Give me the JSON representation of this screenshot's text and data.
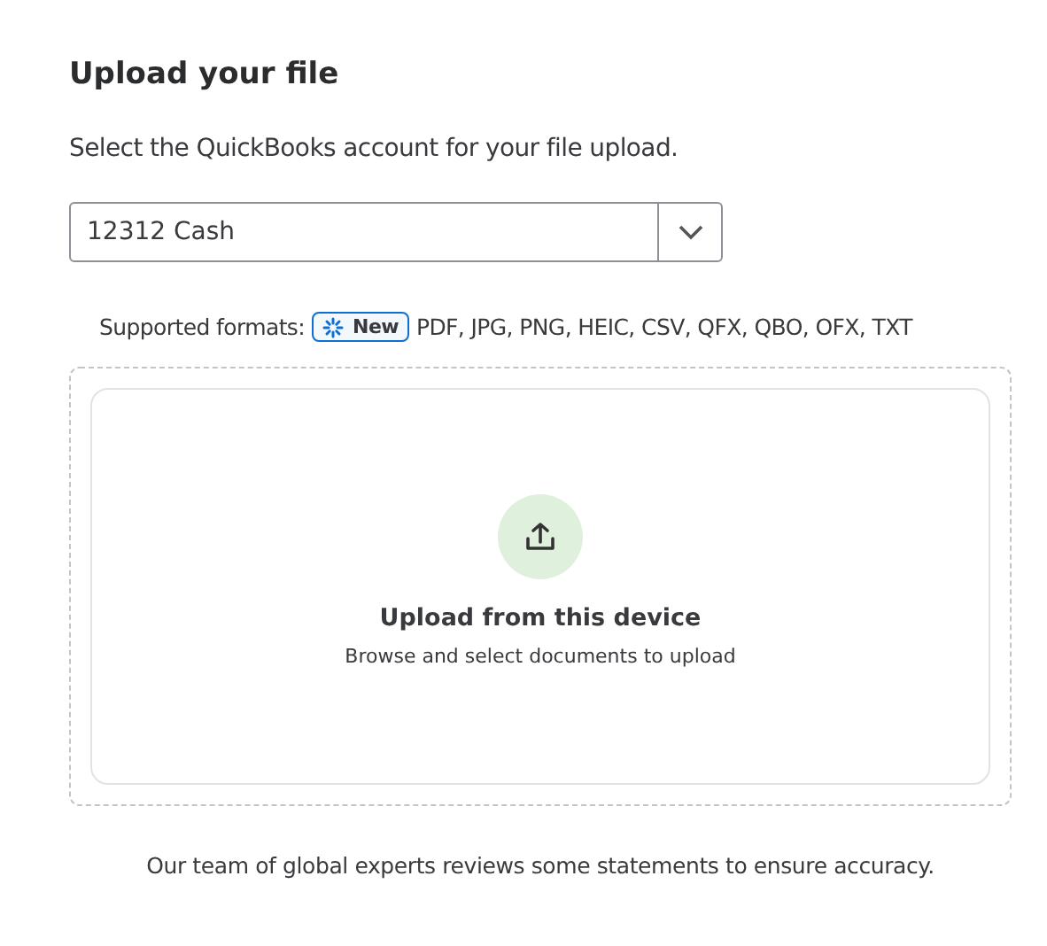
{
  "heading": "Upload your file",
  "instruction": "Select the QuickBooks account for your file upload.",
  "account_select": {
    "value": "12312 Cash"
  },
  "formats": {
    "label": "Supported formats:",
    "badge": "New",
    "list": "PDF, JPG, PNG, HEIC, CSV, QFX, QBO, OFX, TXT"
  },
  "dropzone": {
    "title": "Upload from this device",
    "subtitle": "Browse and select documents to upload"
  },
  "footer_note": "Our team of global experts reviews some statements to ensure accuracy."
}
